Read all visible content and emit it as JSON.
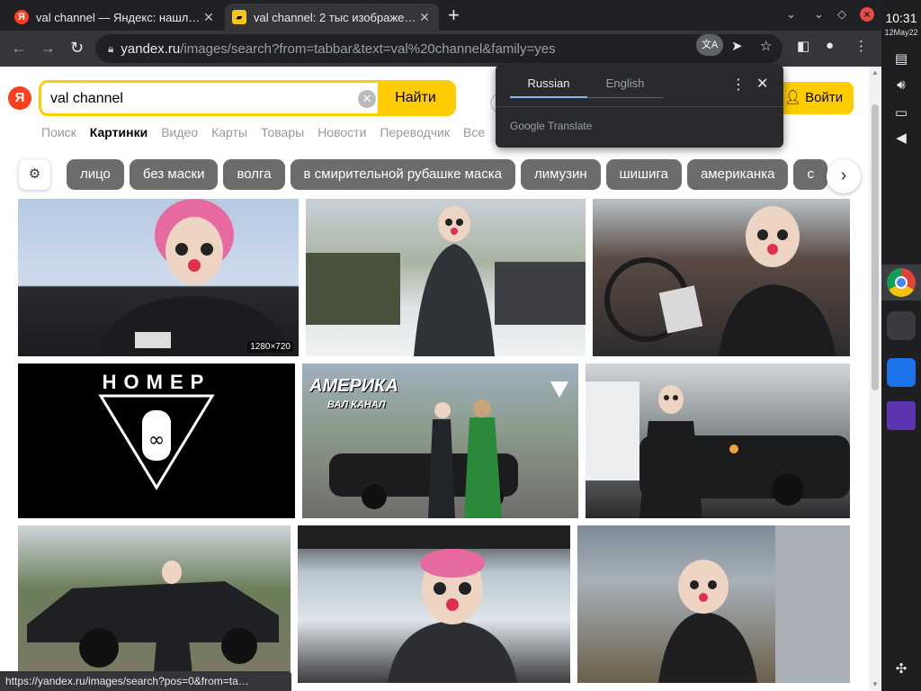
{
  "tabs": [
    {
      "title": "val channel — Яндекс: нашл…",
      "favicon": "Я"
    },
    {
      "title": "val channel: 2 тыс изображе…",
      "favicon": "img"
    }
  ],
  "omnibox": {
    "host": "yandex.ru",
    "path": "/images/search?from=tabbar&text=val%20channel&family=yes"
  },
  "search": {
    "query": "val channel",
    "find_label": "Найти",
    "login_label": "Войти"
  },
  "services": [
    "Поиск",
    "Картинки",
    "Видео",
    "Карты",
    "Товары",
    "Новости",
    "Переводчик",
    "Все"
  ],
  "chips": [
    "лицо",
    "без маски",
    "волга",
    "в смирительной рубашке маска",
    "лимузин",
    "шишига",
    "американка",
    "с"
  ],
  "tiles": {
    "resolution_badge": "1280×720",
    "banner1_text": "НОМЕР",
    "banner2_title": "АМЕРИКА",
    "banner2_sub": "ВАЛ КАНАЛ"
  },
  "translate_popup": {
    "source": "Russian",
    "target": "English",
    "footer": "Google Translate"
  },
  "status_url": "https://yandex.ru/images/search?pos=0&from=ta…",
  "shelf": {
    "time": "10:31",
    "date": "12May22"
  },
  "colors": {
    "yandex_yellow": "#ffcc00",
    "yandex_red": "#fc3f1d",
    "chip_gray": "#6c6c6c"
  }
}
